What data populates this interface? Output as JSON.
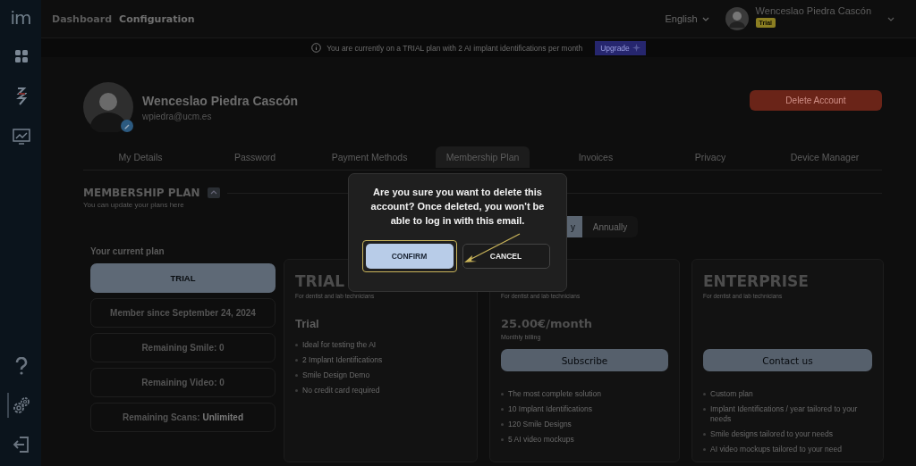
{
  "sidebar": {
    "logo": "im",
    "items": [
      {
        "kind": "grid",
        "selected": false
      },
      {
        "kind": "zigzag",
        "selected": false
      },
      {
        "kind": "chart",
        "selected": false
      },
      {
        "kind": "help",
        "selected": false
      },
      {
        "kind": "settings",
        "selected": true
      },
      {
        "kind": "logout",
        "selected": false
      }
    ]
  },
  "breadcrumb": [
    {
      "label": "Dashboard",
      "selected": false
    },
    {
      "label": "Configuration",
      "selected": true
    }
  ],
  "top_bar": {
    "language": "English",
    "user_name": "Wenceslao Piedra Cascón",
    "plan_badge": "Trial"
  },
  "banner": {
    "text": "You are currently on a TRIAL plan with 2 AI implant identifications per month",
    "button": "Upgrade"
  },
  "profile": {
    "name": "Wenceslao Piedra Cascón",
    "email": "wpiedra@ucm.es",
    "delete_button": "Delete Account"
  },
  "tabs": [
    {
      "label": "My Details",
      "selected": false
    },
    {
      "label": "Password",
      "selected": false
    },
    {
      "label": "Payment Methods",
      "selected": false
    },
    {
      "label": "Membership Plan",
      "selected": true
    },
    {
      "label": "Invoices",
      "selected": false
    },
    {
      "label": "Privacy",
      "selected": false
    },
    {
      "label": "Device Manager",
      "selected": false
    }
  ],
  "membership": {
    "title": "MEMBERSHIP PLAN",
    "subtitle": "You can update your plans here",
    "billing_toggle": [
      {
        "label": "y",
        "selected": true
      },
      {
        "label": "Annually",
        "selected": false
      }
    ],
    "current_plan": {
      "label": "Your current plan",
      "plan": "TRIAL",
      "stats": [
        {
          "text": "Member since September 24, 2024"
        },
        {
          "text": "Remaining Smile: 0"
        },
        {
          "text": "Remaining Video: 0"
        },
        {
          "text": "Remaining Scans: **Unlimited**"
        }
      ]
    },
    "plans": [
      {
        "title": "TRIAL",
        "subtitle": "For dentist and lab technicians",
        "name": "Trial",
        "features": [
          "Ideal for testing the AI",
          "2 Implant Identifications",
          "Smile Design Demo",
          "No credit card required"
        ]
      },
      {
        "subtitle": "For dentist and lab technicians",
        "price": "25.00€/month",
        "billing": "Monthly billing",
        "button": "Subscribe",
        "features": [
          "The most complete solution",
          "10 Implant Identifications",
          "120 Smile Designs",
          "5 AI video mockups"
        ]
      },
      {
        "title": "ENTERPRISE",
        "subtitle": "For dentist and lab technicians",
        "button": "Contact us",
        "features": [
          "Custom plan",
          "Implant Identifications / year tailored to your needs",
          "Smile designs tailored to your needs",
          "AI video mockups tailored to your need"
        ]
      }
    ]
  },
  "dialog": {
    "message": "Are you sure you want to delete this account? Once deleted, you won't be able to log in with this email.",
    "buttons": [
      {
        "label": "CONFIRM",
        "kind": "primary",
        "highlighted": true
      },
      {
        "label": "CANCEL",
        "kind": "secondary",
        "highlighted": false
      }
    ]
  }
}
